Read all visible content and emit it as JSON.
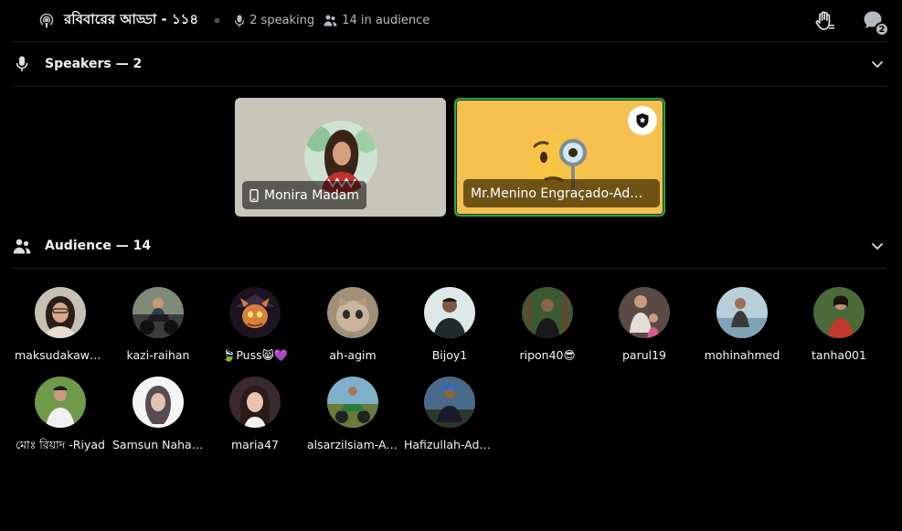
{
  "header": {
    "title": "রবিবারের আড্ডা - ১১৪",
    "speaking": "2 speaking",
    "audience": "14 in audience",
    "chat_badge": "2"
  },
  "speakers": {
    "label": "Speakers — 2",
    "items": [
      {
        "name": "Monira Madam"
      },
      {
        "name": "Mr.Menino Engraçado-Admin"
      }
    ]
  },
  "audience": {
    "label": "Audience — 14",
    "items": [
      {
        "name": "maksudakawsar"
      },
      {
        "name": "kazi-raihan"
      },
      {
        "name": "🍃Puss😸💜"
      },
      {
        "name": "ah-agim"
      },
      {
        "name": "Bijoy1"
      },
      {
        "name": "ripon40😎"
      },
      {
        "name": "parul19"
      },
      {
        "name": "mohinahmed"
      },
      {
        "name": "tanha001"
      },
      {
        "name": "মোঃ রিয়াদ -Riyad"
      },
      {
        "name": "Samsun Nahar Sumi"
      },
      {
        "name": "maria47"
      },
      {
        "name": "alsarzilsiam-Admin"
      },
      {
        "name": "Hafizullah-Admin"
      }
    ]
  },
  "icons": {
    "stage": "stage-channel-icon",
    "mic": "microphone-icon",
    "people": "people-icon",
    "hand": "raise-hand-icon",
    "chat": "chat-bubble-icon",
    "chevron": "chevron-down-icon",
    "phone": "mobile-phone-icon",
    "moderator": "moderator-shield-icon"
  },
  "colors": {
    "background": "#000000",
    "speaking_ring": "#2e9e52",
    "tile_1": "#c7c6b8",
    "tile_2": "#f5c04f"
  }
}
